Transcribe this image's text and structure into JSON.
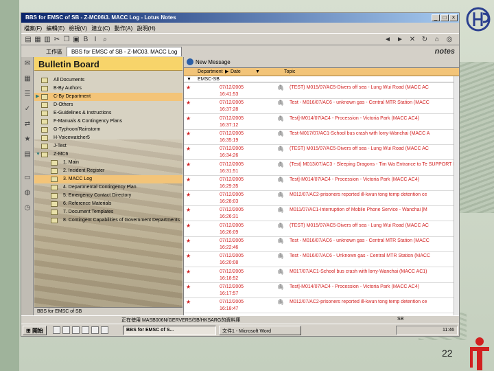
{
  "window": {
    "title": "BBS for EMSC of SB - Z-MC06\\3. MACC Log - Lotus Notes",
    "menu": [
      "檔案(F)",
      "編輯(E)",
      "檢視(V)",
      "建立(C)",
      "動作(A)",
      "說明(H)"
    ]
  },
  "tabs": [
    {
      "label": "工作區"
    },
    {
      "label": "BBS for EMSC of SB - Z-MC03. MACC Log"
    }
  ],
  "brand": "notes",
  "navigator": {
    "title": "Bulletin Board",
    "items": [
      {
        "label": "All Documents",
        "level": 0
      },
      {
        "label": "B-By Authors",
        "level": 0
      },
      {
        "label": "C-By Department",
        "level": 0,
        "selected": true
      },
      {
        "label": "D-Others",
        "level": 0
      },
      {
        "label": "E-Guidelines & Instructions",
        "level": 0
      },
      {
        "label": "F-Manuals & Contingency Plans",
        "level": 0
      },
      {
        "label": "G-Typhoon/Rainstorm",
        "level": 0
      },
      {
        "label": "H-Voicewatcher5",
        "level": 0
      },
      {
        "label": "J-Test",
        "level": 0
      },
      {
        "label": "Z-MC6",
        "level": 0,
        "expanded": true
      },
      {
        "label": "1. Main",
        "level": 1
      },
      {
        "label": "2. Incident Register",
        "level": 1
      },
      {
        "label": "3. MACC Log",
        "level": 1,
        "selected": true
      },
      {
        "label": "4. Departmental Contingency Plan",
        "level": 1
      },
      {
        "label": "5. Emergency Contact Directory",
        "level": 1
      },
      {
        "label": "6. Reference Materials",
        "level": 1
      },
      {
        "label": "7. Document Templates",
        "level": 1
      },
      {
        "label": "8. Contingent Capabilities of Government Departments",
        "level": 1
      }
    ],
    "footer": "BBS for EMSC of SB"
  },
  "view": {
    "action": "New Message",
    "columns": {
      "department": "Department",
      "date": "Date",
      "topic": "Topic"
    },
    "category": "EMSC-SB",
    "rows": [
      {
        "date": "07/12/2005",
        "time": "16:41:53",
        "topic": "(TEST) M015/07/AC5-Divers off sea - Lung Wui Road (MACC AC"
      },
      {
        "date": "07/12/2005",
        "time": "16:37:28",
        "topic": "Test - M016/07/AC6 - unknown gas - Central MTR Station (MACC"
      },
      {
        "date": "07/12/2005",
        "time": "16:37:12",
        "topic": "Test]-M014/07/AC4 - Procession - Victoria Park (MACC AC4)"
      },
      {
        "date": "07/12/2005",
        "time": "16:35:19",
        "topic": "Test-M017/07/AC1-School bus crash with lorry-Wanchai (MACC A"
      },
      {
        "date": "07/12/2005",
        "time": "16:34:26",
        "topic": "(TEST) M015/07/AC5-Divers off sea - Lung Wui Road (MACC AC"
      },
      {
        "date": "07/12/2005",
        "time": "16:31:51",
        "topic": "(Test) M013/07/AC3 - Sleeping Dragons - Tim Wa Entrance to Te SUPPORT ESU1)"
      },
      {
        "date": "07/12/2005",
        "time": "16:29:35",
        "topic": "Test]-M014/07/AC4 - Procession - Victoria Park (MACC AC4)"
      },
      {
        "date": "07/12/2005",
        "time": "16:28:03",
        "topic": "M012/07/AC2-prisoners reported ill-kwun tong temp detention ce"
      },
      {
        "date": "07/12/2005",
        "time": "16:26:31",
        "topic": "M011/07/AC1-Interruption of Mobile Phone Service - Wanchai [M"
      },
      {
        "date": "07/12/2005",
        "time": "16:26:09",
        "topic": "(TEST) M015/07/AC5-Divers off sea - Lung Wui Road (MACC AC"
      },
      {
        "date": "07/12/2005",
        "time": "16:22:46",
        "topic": "Test - M016/07/AC6 - unknown gas - Central MTR Station (MACC"
      },
      {
        "date": "07/12/2005",
        "time": "16:20:08",
        "topic": "Test - M016/07/AC6 - Unknown gas - Central MTR Station (MACC"
      },
      {
        "date": "07/12/2005",
        "time": "16:18:52",
        "topic": "M017/07/AC1-School bus crash with lorry-Wanchai (MACC AC1)"
      },
      {
        "date": "07/12/2005",
        "time": "16:17:57",
        "topic": "Test]-M014/07/AC4 - Procession - Victoria Park (MACC AC4)"
      },
      {
        "date": "07/12/2005",
        "time": "16:18:47",
        "topic": "M012/07/AC2-prisoners reported ill-kwun tong temp detention ce"
      }
    ]
  },
  "status": {
    "text": "正在使用 MASB006N/GERVERS/SB/HKSARG的資料庫",
    "right": "SB"
  },
  "taskbar": {
    "start": "開始",
    "tasks": [
      "BBS for EMSC of S...",
      "文件1 - Microsoft Word"
    ],
    "clock": "11:46"
  },
  "slide": {
    "page_number": "22"
  }
}
